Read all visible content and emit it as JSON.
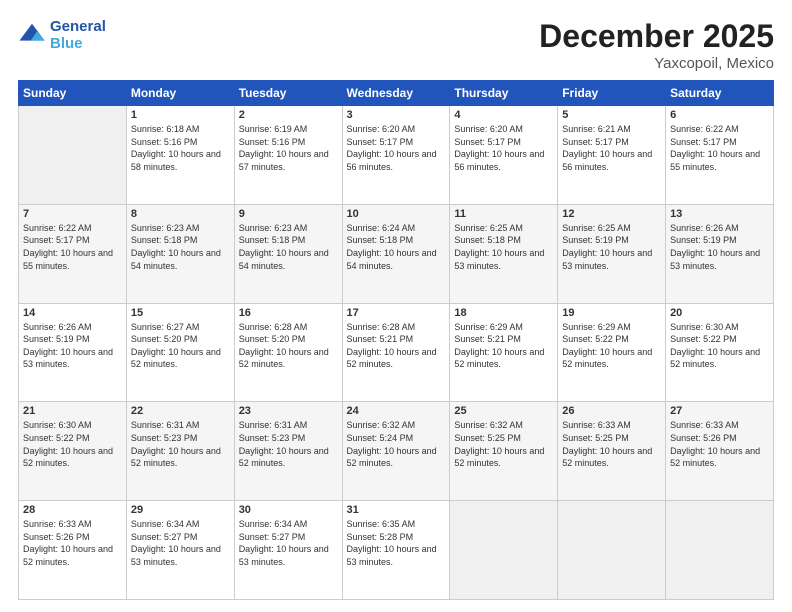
{
  "header": {
    "logo_line1": "General",
    "logo_line2": "Blue",
    "month": "December 2025",
    "location": "Yaxcopoil, Mexico"
  },
  "days_of_week": [
    "Sunday",
    "Monday",
    "Tuesday",
    "Wednesday",
    "Thursday",
    "Friday",
    "Saturday"
  ],
  "weeks": [
    [
      {
        "day": "",
        "empty": true
      },
      {
        "day": "1",
        "sunrise": "6:18 AM",
        "sunset": "5:16 PM",
        "daylight": "10 hours and 58 minutes."
      },
      {
        "day": "2",
        "sunrise": "6:19 AM",
        "sunset": "5:16 PM",
        "daylight": "10 hours and 57 minutes."
      },
      {
        "day": "3",
        "sunrise": "6:20 AM",
        "sunset": "5:17 PM",
        "daylight": "10 hours and 56 minutes."
      },
      {
        "day": "4",
        "sunrise": "6:20 AM",
        "sunset": "5:17 PM",
        "daylight": "10 hours and 56 minutes."
      },
      {
        "day": "5",
        "sunrise": "6:21 AM",
        "sunset": "5:17 PM",
        "daylight": "10 hours and 56 minutes."
      },
      {
        "day": "6",
        "sunrise": "6:22 AM",
        "sunset": "5:17 PM",
        "daylight": "10 hours and 55 minutes."
      }
    ],
    [
      {
        "day": "7",
        "sunrise": "6:22 AM",
        "sunset": "5:17 PM",
        "daylight": "10 hours and 55 minutes."
      },
      {
        "day": "8",
        "sunrise": "6:23 AM",
        "sunset": "5:18 PM",
        "daylight": "10 hours and 54 minutes."
      },
      {
        "day": "9",
        "sunrise": "6:23 AM",
        "sunset": "5:18 PM",
        "daylight": "10 hours and 54 minutes."
      },
      {
        "day": "10",
        "sunrise": "6:24 AM",
        "sunset": "5:18 PM",
        "daylight": "10 hours and 54 minutes."
      },
      {
        "day": "11",
        "sunrise": "6:25 AM",
        "sunset": "5:18 PM",
        "daylight": "10 hours and 53 minutes."
      },
      {
        "day": "12",
        "sunrise": "6:25 AM",
        "sunset": "5:19 PM",
        "daylight": "10 hours and 53 minutes."
      },
      {
        "day": "13",
        "sunrise": "6:26 AM",
        "sunset": "5:19 PM",
        "daylight": "10 hours and 53 minutes."
      }
    ],
    [
      {
        "day": "14",
        "sunrise": "6:26 AM",
        "sunset": "5:19 PM",
        "daylight": "10 hours and 53 minutes."
      },
      {
        "day": "15",
        "sunrise": "6:27 AM",
        "sunset": "5:20 PM",
        "daylight": "10 hours and 52 minutes."
      },
      {
        "day": "16",
        "sunrise": "6:28 AM",
        "sunset": "5:20 PM",
        "daylight": "10 hours and 52 minutes."
      },
      {
        "day": "17",
        "sunrise": "6:28 AM",
        "sunset": "5:21 PM",
        "daylight": "10 hours and 52 minutes."
      },
      {
        "day": "18",
        "sunrise": "6:29 AM",
        "sunset": "5:21 PM",
        "daylight": "10 hours and 52 minutes."
      },
      {
        "day": "19",
        "sunrise": "6:29 AM",
        "sunset": "5:22 PM",
        "daylight": "10 hours and 52 minutes."
      },
      {
        "day": "20",
        "sunrise": "6:30 AM",
        "sunset": "5:22 PM",
        "daylight": "10 hours and 52 minutes."
      }
    ],
    [
      {
        "day": "21",
        "sunrise": "6:30 AM",
        "sunset": "5:22 PM",
        "daylight": "10 hours and 52 minutes."
      },
      {
        "day": "22",
        "sunrise": "6:31 AM",
        "sunset": "5:23 PM",
        "daylight": "10 hours and 52 minutes."
      },
      {
        "day": "23",
        "sunrise": "6:31 AM",
        "sunset": "5:23 PM",
        "daylight": "10 hours and 52 minutes."
      },
      {
        "day": "24",
        "sunrise": "6:32 AM",
        "sunset": "5:24 PM",
        "daylight": "10 hours and 52 minutes."
      },
      {
        "day": "25",
        "sunrise": "6:32 AM",
        "sunset": "5:25 PM",
        "daylight": "10 hours and 52 minutes."
      },
      {
        "day": "26",
        "sunrise": "6:33 AM",
        "sunset": "5:25 PM",
        "daylight": "10 hours and 52 minutes."
      },
      {
        "day": "27",
        "sunrise": "6:33 AM",
        "sunset": "5:26 PM",
        "daylight": "10 hours and 52 minutes."
      }
    ],
    [
      {
        "day": "28",
        "sunrise": "6:33 AM",
        "sunset": "5:26 PM",
        "daylight": "10 hours and 52 minutes."
      },
      {
        "day": "29",
        "sunrise": "6:34 AM",
        "sunset": "5:27 PM",
        "daylight": "10 hours and 53 minutes."
      },
      {
        "day": "30",
        "sunrise": "6:34 AM",
        "sunset": "5:27 PM",
        "daylight": "10 hours and 53 minutes."
      },
      {
        "day": "31",
        "sunrise": "6:35 AM",
        "sunset": "5:28 PM",
        "daylight": "10 hours and 53 minutes."
      },
      {
        "day": "",
        "empty": true
      },
      {
        "day": "",
        "empty": true
      },
      {
        "day": "",
        "empty": true
      }
    ]
  ]
}
